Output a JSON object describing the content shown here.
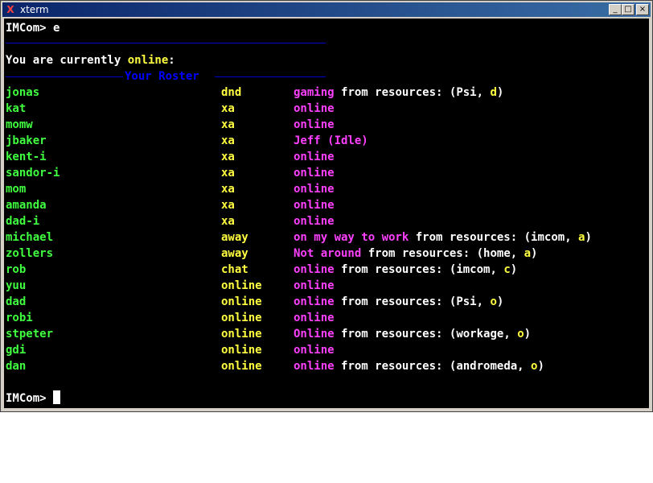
{
  "window": {
    "title": "xterm",
    "icon": "x-icon",
    "buttons": {
      "minimize": "_",
      "maximize": "□",
      "close": "×"
    }
  },
  "terminal": {
    "first_prompt": "IMCom>",
    "first_command": "e",
    "online_prefix": "You are currently ",
    "online_word": "online",
    "online_suffix": ":",
    "roster_title": "Your Roster",
    "from_resources": "from resources: (",
    "comma": ", ",
    "close_paren": ")",
    "last_prompt": "IMCom>"
  },
  "roster": [
    {
      "name": "jonas",
      "show": "dnd",
      "message": "gaming",
      "resource": "Psi",
      "priority": "d"
    },
    {
      "name": "kat",
      "show": "xa",
      "message": "online"
    },
    {
      "name": "momw",
      "show": "xa",
      "message": "online"
    },
    {
      "name": "jbaker",
      "show": "xa",
      "message": "Jeff (Idle)"
    },
    {
      "name": "kent-i",
      "show": "xa",
      "message": "online"
    },
    {
      "name": "sandor-i",
      "show": "xa",
      "message": "online"
    },
    {
      "name": "mom",
      "show": "xa",
      "message": "online"
    },
    {
      "name": "amanda",
      "show": "xa",
      "message": "online"
    },
    {
      "name": "dad-i",
      "show": "xa",
      "message": "online"
    },
    {
      "name": "michael",
      "show": "away",
      "message": "on my way to work",
      "resource": "imcom",
      "priority": "a"
    },
    {
      "name": "zollers",
      "show": "away",
      "message": "Not around",
      "resource": "home",
      "priority": "a"
    },
    {
      "name": "rob",
      "show": "chat",
      "message": "online",
      "resource": "imcom",
      "priority": "c"
    },
    {
      "name": "yuu",
      "show": "online",
      "message": "online"
    },
    {
      "name": "dad",
      "show": "online",
      "message": "online",
      "resource": "Psi",
      "priority": "o"
    },
    {
      "name": "robi",
      "show": "online",
      "message": "online"
    },
    {
      "name": "stpeter",
      "show": "online",
      "message": "Online",
      "resource": "workage",
      "priority": "o"
    },
    {
      "name": "gdi",
      "show": "online",
      "message": "online"
    },
    {
      "name": "dan",
      "show": "online",
      "message": "online",
      "resource": "andromeda",
      "priority": "o"
    }
  ],
  "colors": {
    "terminal_bg": "#000000",
    "name": "#40ff40",
    "show": "#ffff40",
    "message": "#ff40ff",
    "text": "#ffffff",
    "rule": "#0000cc"
  }
}
